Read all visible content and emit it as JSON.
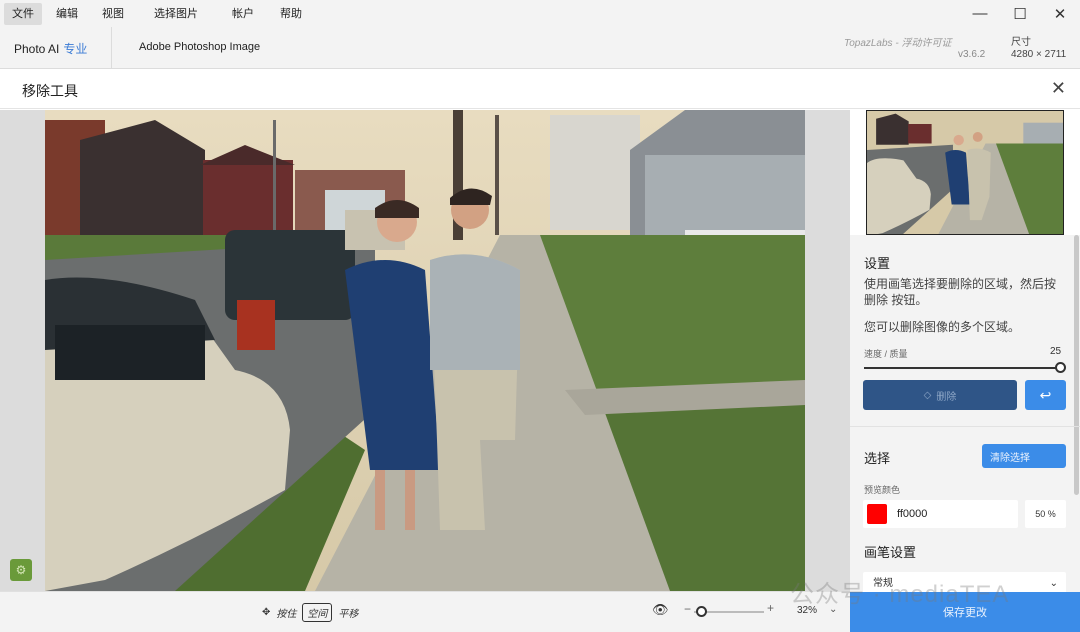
{
  "menu": {
    "items": [
      "文件",
      "编辑",
      "视图",
      "选择图片",
      "帐户",
      "帮助"
    ],
    "active_index": 0
  },
  "window_controls": {
    "minimize": "—",
    "maximize": "☐",
    "close": "✕"
  },
  "header": {
    "brand": "Photo AI",
    "brand_tier": "专业",
    "document_name": "Adobe Photoshop Image",
    "license": "TopazLabs - 浮动许可证",
    "version": "v3.6.2",
    "size_label": "尺寸",
    "size_value": "4280 × 2711"
  },
  "tool": {
    "title": "移除工具",
    "close": "✕"
  },
  "canvas": {
    "pan_hint": {
      "label_press": "按住",
      "key": "空间",
      "label_action": "平移"
    },
    "zoom_value": "32%"
  },
  "panel": {
    "settings": {
      "title": "设置",
      "desc1": "使用画笔选择要删除的区域，然后按 删除 按钮。",
      "desc2": "您可以删除图像的多个区域。",
      "slider_label": "速度 / 质量",
      "slider_value": "25",
      "slider_fraction": 1.0,
      "remove_label": "删除"
    },
    "selection": {
      "title": "选择",
      "clear_label": "清除选择",
      "preview_color_label": "预览颜色",
      "color_hex": "ff0000",
      "color": "#ff0000",
      "opacity": "50 %"
    },
    "brush": {
      "title": "画笔设置",
      "mode": "常规"
    },
    "save_label": "保存更改"
  },
  "watermark": "公众号 · mediaTEA",
  "colors": {
    "accent": "#3b8ce8",
    "accent_dark": "#2f5587"
  }
}
